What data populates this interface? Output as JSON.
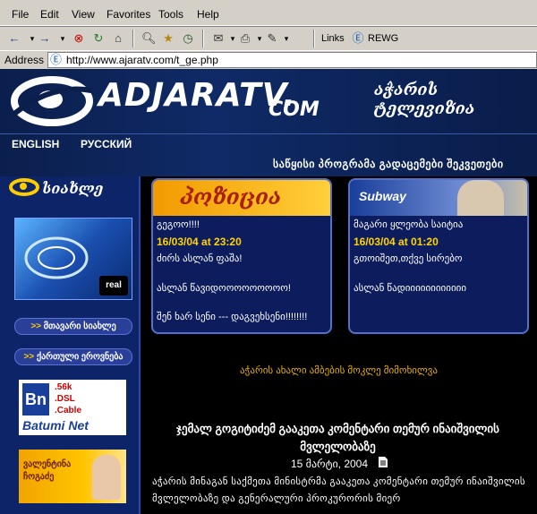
{
  "menu": [
    "File",
    "Edit",
    "View",
    "Favorites",
    "Tools",
    "Help"
  ],
  "toolbar": {
    "links_label": "Links",
    "rewg_label": "REWG"
  },
  "address": {
    "label": "Address",
    "url": "http://www.ajaratv.com/t_ge.php"
  },
  "header": {
    "logo_main": "ADJARATV.",
    "logo_com": "COM",
    "logo_geo": "აჭარის ტელევიზია",
    "lang_en": "ENGLISH",
    "lang_ru": "РУССКИЙ",
    "nav_geo": "საწყისი პროგრამა გადაცემები შეკვეთები"
  },
  "sidebar": {
    "home_label": "სიახლე",
    "btn1": "მთავარი სიახლე",
    "btn2": "ქართული ეროვნება",
    "batumi_net": "Batumi Net",
    "batumi_lines": [
      ".56k",
      ".DSL",
      ".Cable"
    ],
    "real_badge": "real",
    "valentina_text": "ვალენტინა ჩოგაძე"
  },
  "cards": [
    {
      "header_text": "პოზიცია",
      "subtitle": "გეგოო!!!!",
      "date": "16/03/04  at 23:20",
      "line1": "ძირს ასლან ფაშა!",
      "line2": "ასლან წავიდოოოოოოოოო!",
      "line3": "შენ ხარ სენი --- დაგვეხსენი!!!!!!!!"
    },
    {
      "header_text": "Subway",
      "subtitle": "მაგარი ყლეობა საიტია",
      "date": "16/03/04  at 01:20",
      "line1": "გთოიშეთ,თქვე სირებო",
      "line2": "ასლან წადიიიიიიიიიიიი"
    }
  ],
  "main": {
    "subtitle": "აჭარის ახალი ამბების მოკლე მიმოხილვა",
    "headline": "ჯემალ გოგიტიძემ გააკეთა კომენტარი თემურ ინაიშვილის მვლელობაზე",
    "date": "15 მარტი, 2004",
    "body": "აჭარის მინაგან საქმეთა მინისტრმა გააკეთა კომენტარი თემურ ინაიშვილის მვლელობაზე და გენერალური პროკურორის მიერ"
  },
  "colors": {
    "accent": "#ffd400",
    "panel": "#0c1c5c",
    "sidebar": "#0e2468"
  }
}
